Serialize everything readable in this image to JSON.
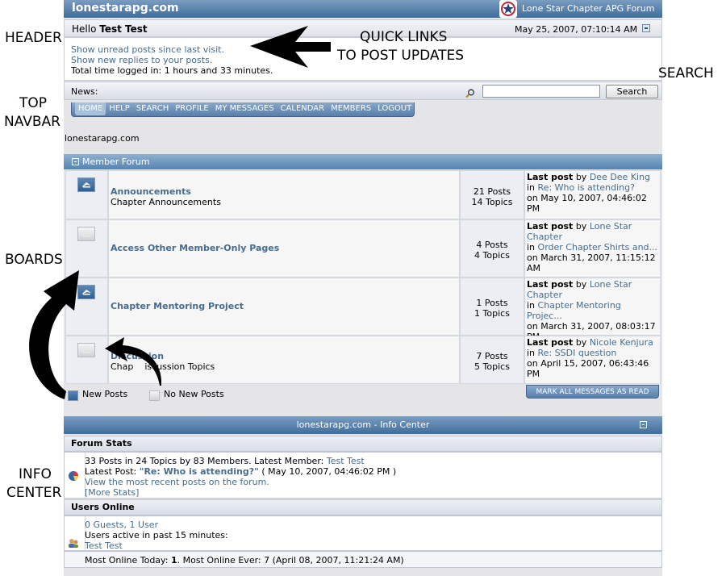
{
  "annotations": {
    "header": "HEADER",
    "quick_links_line1": "QUICK LINKS",
    "quick_links_line2": "TO POST UPDATES",
    "search": "SEARCH",
    "top_navbar_line1": "TOP",
    "top_navbar_line2": "NAVBAR",
    "boards": "BOARDS",
    "info_center_line1": "INFO",
    "info_center_line2": "CENTER"
  },
  "site": {
    "title": "lonestarapg.com",
    "forum_name": "Lone Star Chapter APG Forum",
    "breadcrumb": "lonestarapg.com"
  },
  "user": {
    "hello": "Hello",
    "name": "Test Test",
    "datetime": "May 25, 2007, 07:10:14 AM",
    "unread_link": "Show unread posts since last visit.",
    "replies_link": "Show new replies to your posts.",
    "time_logged": "Total time logged in: 1 hours and 33 minutes."
  },
  "news": {
    "label": "News:",
    "search_placeholder": "",
    "search_button": "Search"
  },
  "nav": {
    "tabs": [
      "HOME",
      "HELP",
      "SEARCH",
      "PROFILE",
      "MY MESSAGES",
      "CALENDAR",
      "MEMBERS",
      "LOGOUT"
    ]
  },
  "category": {
    "title": "Member Forum",
    "boards": [
      {
        "name": "Announcements",
        "description": "Chapter Announcements",
        "posts": "21 Posts",
        "topics": "14 Topics",
        "lp_label": "Last post",
        "lp_by": "by",
        "lp_author": "Dee Dee King",
        "lp_in": "in",
        "lp_topic": "Re: Who is attending?",
        "lp_date": "on May 10, 2007, 04:46:02 PM",
        "new": true
      },
      {
        "name": "Access Other Member-Only Pages",
        "description": "",
        "posts": "4 Posts",
        "topics": "4 Topics",
        "lp_label": "Last post",
        "lp_by": "by",
        "lp_author": "Lone Star Chapter",
        "lp_in": "in",
        "lp_topic": "Order Chapter Shirts and...",
        "lp_date": "on March 31, 2007, 11:15:12 AM",
        "new": false
      },
      {
        "name": "Chapter Mentoring Project",
        "description": "",
        "posts": "1 Posts",
        "topics": "1 Topics",
        "lp_label": "Last post",
        "lp_by": "by",
        "lp_author": "Lone Star Chapter",
        "lp_in": "in",
        "lp_topic": "Chapter Mentoring Projec...",
        "lp_date": "on March 31, 2007, 08:03:17 PM",
        "new": true
      },
      {
        "name": "Discussion",
        "description": "Chap    iscussion Topics",
        "posts": "7 Posts",
        "topics": "5 Topics",
        "lp_label": "Last post",
        "lp_by": "by",
        "lp_author": "Nicole Kenjura",
        "lp_in": "in",
        "lp_topic": "Re: SSDI question",
        "lp_date": "on April 15, 2007, 06:43:46 PM",
        "new": false
      }
    ]
  },
  "legend": {
    "new_posts": "New Posts",
    "no_new_posts": "No New Posts",
    "mark_read": "MARK ALL MESSAGES AS READ"
  },
  "info_center": {
    "title": "lonestarapg.com - Info Center",
    "stats_heading": "Forum Stats",
    "stats_line": "33 Posts in 24 Topics by 83 Members. Latest Member:",
    "latest_member": "Test Test",
    "latest_post_label": "Latest Post:",
    "latest_post_title": "\"Re: Who is attending?\"",
    "latest_post_date": "( May 10, 2007, 04:46:02 PM )",
    "recent_link": "View the most recent posts on the forum.",
    "more_stats": "[More Stats]",
    "users_heading": "Users Online",
    "guests_users": "0 Guests, 1 User",
    "active_label": "Users active in past 15 minutes:",
    "active_user": "Test Test",
    "most_online_prefix": "Most Online Today:",
    "most_online_today": "1",
    "most_online_ever": ". Most Online Ever: 7 (April 08, 2007, 11:21:24 AM)"
  }
}
